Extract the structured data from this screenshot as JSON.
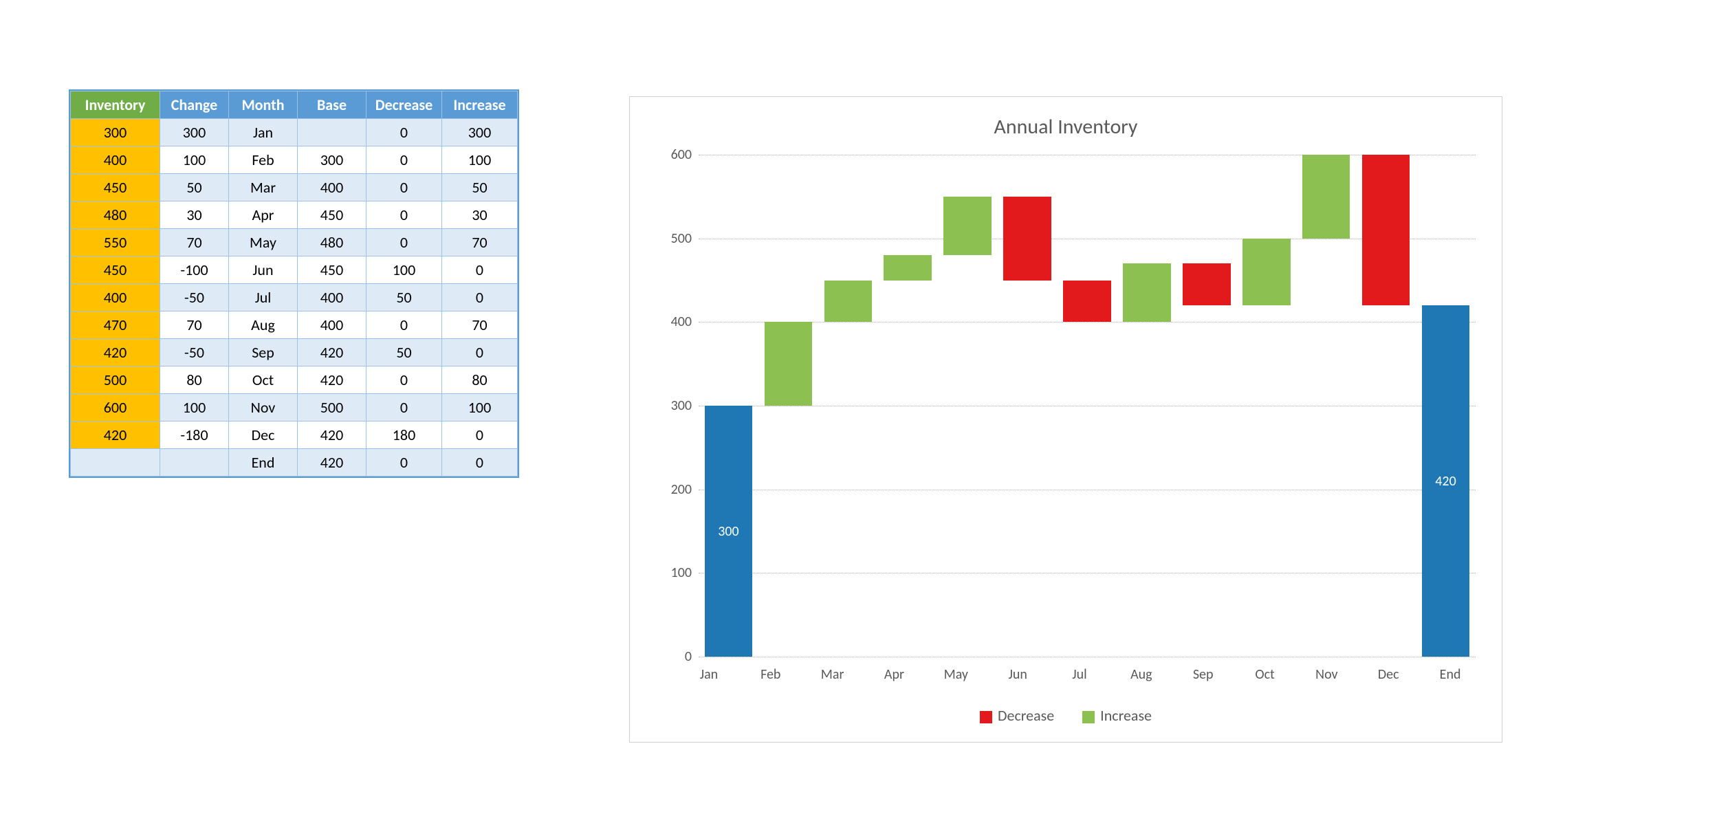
{
  "table": {
    "headers": [
      "Inventory",
      "Change",
      "Month",
      "Base",
      "Decrease",
      "Increase"
    ],
    "rows": [
      {
        "inventory": "300",
        "change": "300",
        "month": "Jan",
        "base": "",
        "decrease": "0",
        "increase": "300"
      },
      {
        "inventory": "400",
        "change": "100",
        "month": "Feb",
        "base": "300",
        "decrease": "0",
        "increase": "100"
      },
      {
        "inventory": "450",
        "change": "50",
        "month": "Mar",
        "base": "400",
        "decrease": "0",
        "increase": "50"
      },
      {
        "inventory": "480",
        "change": "30",
        "month": "Apr",
        "base": "450",
        "decrease": "0",
        "increase": "30"
      },
      {
        "inventory": "550",
        "change": "70",
        "month": "May",
        "base": "480",
        "decrease": "0",
        "increase": "70"
      },
      {
        "inventory": "450",
        "change": "-100",
        "month": "Jun",
        "base": "450",
        "decrease": "100",
        "increase": "0"
      },
      {
        "inventory": "400",
        "change": "-50",
        "month": "Jul",
        "base": "400",
        "decrease": "50",
        "increase": "0"
      },
      {
        "inventory": "470",
        "change": "70",
        "month": "Aug",
        "base": "400",
        "decrease": "0",
        "increase": "70"
      },
      {
        "inventory": "420",
        "change": "-50",
        "month": "Sep",
        "base": "420",
        "decrease": "50",
        "increase": "0"
      },
      {
        "inventory": "500",
        "change": "80",
        "month": "Oct",
        "base": "420",
        "decrease": "0",
        "increase": "80"
      },
      {
        "inventory": "600",
        "change": "100",
        "month": "Nov",
        "base": "500",
        "decrease": "0",
        "increase": "100"
      },
      {
        "inventory": "420",
        "change": "-180",
        "month": "Dec",
        "base": "420",
        "decrease": "180",
        "increase": "0"
      },
      {
        "inventory": "",
        "change": "",
        "month": "End",
        "base": "420",
        "decrease": "0",
        "increase": "0"
      }
    ]
  },
  "chart_data": {
    "type": "bar",
    "title": "Annual Inventory",
    "categories": [
      "Jan",
      "Feb",
      "Mar",
      "Apr",
      "May",
      "Jun",
      "Jul",
      "Aug",
      "Sep",
      "Oct",
      "Nov",
      "Dec",
      "End"
    ],
    "y_ticks": [
      0,
      100,
      200,
      300,
      400,
      500,
      600
    ],
    "ylim": [
      0,
      600
    ],
    "legend": [
      "Decrease",
      "Increase"
    ],
    "colors": {
      "decrease": "#e21a1c",
      "increase": "#8cc152",
      "total": "#1f77b4"
    },
    "bars": [
      {
        "cat": "Jan",
        "kind": "total",
        "from": 0,
        "to": 300,
        "label": "300"
      },
      {
        "cat": "Feb",
        "kind": "inc",
        "from": 300,
        "to": 400
      },
      {
        "cat": "Mar",
        "kind": "inc",
        "from": 400,
        "to": 450
      },
      {
        "cat": "Apr",
        "kind": "inc",
        "from": 450,
        "to": 480
      },
      {
        "cat": "May",
        "kind": "inc",
        "from": 480,
        "to": 550
      },
      {
        "cat": "Jun",
        "kind": "dec",
        "from": 450,
        "to": 550
      },
      {
        "cat": "Jul",
        "kind": "dec",
        "from": 400,
        "to": 450
      },
      {
        "cat": "Aug",
        "kind": "inc",
        "from": 400,
        "to": 470
      },
      {
        "cat": "Sep",
        "kind": "dec",
        "from": 420,
        "to": 470
      },
      {
        "cat": "Oct",
        "kind": "inc",
        "from": 420,
        "to": 500
      },
      {
        "cat": "Nov",
        "kind": "inc",
        "from": 500,
        "to": 600
      },
      {
        "cat": "Dec",
        "kind": "dec",
        "from": 420,
        "to": 600
      },
      {
        "cat": "End",
        "kind": "total",
        "from": 0,
        "to": 420,
        "label": "420"
      }
    ]
  }
}
